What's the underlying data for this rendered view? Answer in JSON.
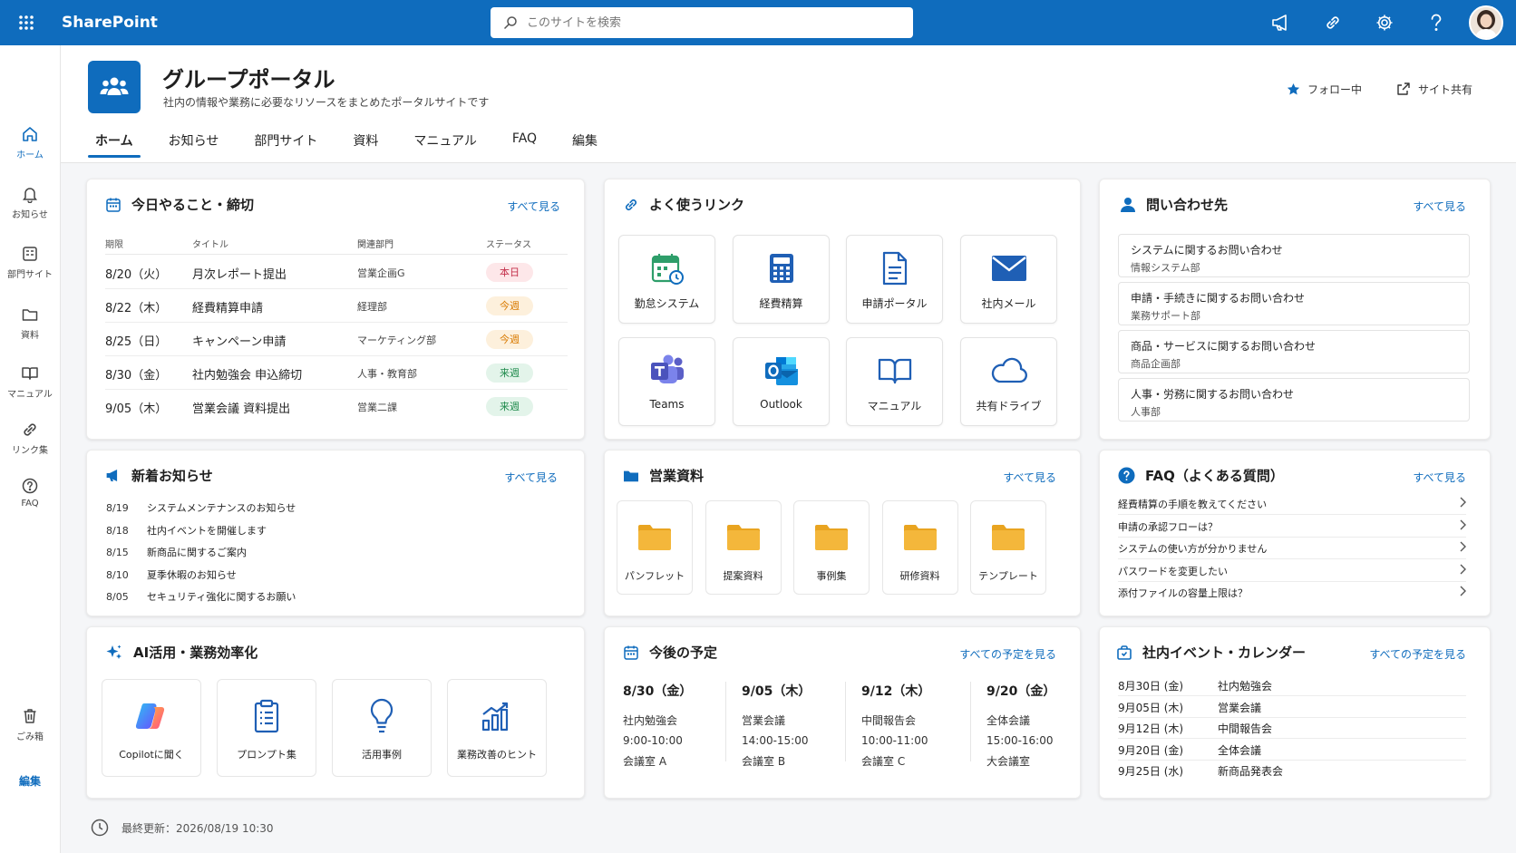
{
  "app": {
    "name": "SharePoint"
  },
  "search": {
    "placeholder": "このサイトを検索"
  },
  "rail": {
    "items": [
      {
        "label": "ホーム",
        "icon": "home-icon"
      },
      {
        "label": "お知らせ",
        "icon": "bell-icon"
      },
      {
        "label": "部門サイト",
        "icon": "site-icon"
      },
      {
        "label": "資料",
        "icon": "folder-icon"
      },
      {
        "label": "マニュアル",
        "icon": "book-icon"
      },
      {
        "label": "リンク集",
        "icon": "link-icon"
      },
      {
        "label": "FAQ",
        "icon": "question-icon"
      }
    ],
    "trash": "ごみ箱",
    "edit": "編集"
  },
  "site": {
    "title": "グループポータル",
    "description": "社内の情報や業務に必要なリソースをまとめたポータルサイトです",
    "follow": "フォロー中",
    "share": "サイト共有",
    "tabs": [
      "ホーム",
      "お知らせ",
      "部門サイト",
      "資料",
      "マニュアル",
      "FAQ",
      "編集"
    ]
  },
  "todo": {
    "title": "今日やること・締切",
    "see_all": "すべて見る",
    "headers": [
      "期限",
      "タイトル",
      "関連部門",
      "ステータス"
    ],
    "rows": [
      {
        "due": "8/20（火）",
        "title": "月次レポート提出",
        "dept": "営業企画G",
        "status": "本日",
        "status_type": "today"
      },
      {
        "due": "8/22（木）",
        "title": "経費精算申請",
        "dept": "経理部",
        "status": "今週",
        "status_type": "week"
      },
      {
        "due": "8/25（日）",
        "title": "キャンペーン申請",
        "dept": "マーケティング部",
        "status": "今週",
        "status_type": "week"
      },
      {
        "due": "8/30（金）",
        "title": "社内勉強会 申込締切",
        "dept": "人事・教育部",
        "status": "来週",
        "status_type": "next"
      },
      {
        "due": "9/05（木）",
        "title": "営業会議 資料提出",
        "dept": "営業二課",
        "status": "来週",
        "status_type": "next"
      }
    ]
  },
  "links": {
    "title": "よく使うリンク",
    "items": [
      {
        "label": "勤怠システム",
        "icon": "attendance-calendar-icon"
      },
      {
        "label": "経費精算",
        "icon": "calculator-icon"
      },
      {
        "label": "申請ポータル",
        "icon": "document-icon"
      },
      {
        "label": "社内メール",
        "icon": "mail-icon"
      },
      {
        "label": "Teams",
        "icon": "teams-icon"
      },
      {
        "label": "Outlook",
        "icon": "outlook-icon"
      },
      {
        "label": "マニュアル",
        "icon": "book-icon"
      },
      {
        "label": "共有ドライブ",
        "icon": "cloud-icon"
      }
    ]
  },
  "contacts": {
    "title": "問い合わせ先",
    "see_all": "すべて見る",
    "items": [
      {
        "title": "システムに関するお問い合わせ",
        "dept": "情報システム部"
      },
      {
        "title": "申請・手続きに関するお問い合わせ",
        "dept": "業務サポート部"
      },
      {
        "title": "商品・サービスに関するお問い合わせ",
        "dept": "商品企画部"
      },
      {
        "title": "人事・労務に関するお問い合わせ",
        "dept": "人事部"
      }
    ]
  },
  "news": {
    "title": "新着お知らせ",
    "see_all": "すべて見る",
    "items": [
      {
        "date": "8/19",
        "text": "システムメンテナンスのお知らせ"
      },
      {
        "date": "8/18",
        "text": "社内イベントを開催します"
      },
      {
        "date": "8/15",
        "text": "新商品に関するご案内"
      },
      {
        "date": "8/10",
        "text": "夏季休暇のお知らせ"
      },
      {
        "date": "8/05",
        "text": "セキュリティ強化に関するお願い"
      }
    ]
  },
  "sales_docs": {
    "title": "営業資料",
    "see_all": "すべて見る",
    "folders": [
      "パンフレット",
      "提案資料",
      "事例集",
      "研修資料",
      "テンプレート"
    ]
  },
  "faq": {
    "title": "FAQ（よくある質問）",
    "see_all": "すべて見る",
    "items": [
      "経費精算の手順を教えてください",
      "申請の承認フローは？",
      "システムの使い方が分かりません",
      "パスワードを変更したい",
      "添付ファイルの容量上限は？"
    ]
  },
  "ai": {
    "title": "AI活用・業務効率化",
    "items": [
      {
        "label": "Copilotに聞く",
        "icon": "copilot-icon"
      },
      {
        "label": "プロンプト集",
        "icon": "clipboard-icon"
      },
      {
        "label": "活用事例",
        "icon": "lightbulb-icon"
      },
      {
        "label": "業務改善のヒント",
        "icon": "chart-icon"
      }
    ]
  },
  "schedule": {
    "title": "今後の予定",
    "see_all": "すべての予定を見る",
    "items": [
      {
        "date": "8/30（金）",
        "event": "社内勉強会",
        "time": "9:00-10:00",
        "room": "会議室 A"
      },
      {
        "date": "9/05（木）",
        "event": "営業会議",
        "time": "14:00-15:00",
        "room": "会議室 B"
      },
      {
        "date": "9/12（木）",
        "event": "中間報告会",
        "time": "10:00-11:00",
        "room": "会議室 C"
      },
      {
        "date": "9/20（金）",
        "event": "全体会議",
        "time": "15:00-16:00",
        "room": "大会議室"
      }
    ]
  },
  "events": {
    "title": "社内イベント・カレンダー",
    "see_all": "すべての予定を見る",
    "items": [
      {
        "date": "8月30日 (金)",
        "name": "社内勉強会"
      },
      {
        "date": "9月05日 (木)",
        "name": "営業会議"
      },
      {
        "date": "9月12日 (木)",
        "name": "中間報告会"
      },
      {
        "date": "9月20日 (金)",
        "name": "全体会議"
      },
      {
        "date": "9月25日 (水)",
        "name": "新商品発表会"
      }
    ]
  },
  "footer": {
    "updated": "最終更新：2026/08/19 10:30"
  },
  "colors": {
    "brand": "#0f6cbd",
    "today_bg": "#fde7e9",
    "today_fg": "#c4314b",
    "week_bg": "#fdf0dc",
    "week_fg": "#d97a00",
    "next_bg": "#e3f4ea",
    "next_fg": "#1f8a4c",
    "folder": "#f4b73b"
  }
}
